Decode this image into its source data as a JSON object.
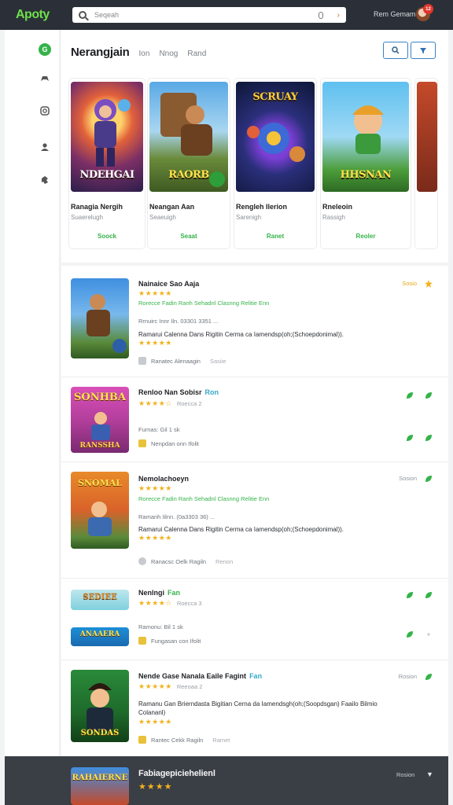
{
  "app": {
    "logo": "Apoty",
    "search_value": "Seqeah",
    "user_name": "Rem Gemam",
    "notif_count": "12"
  },
  "sidebar": {
    "items": [
      {
        "icon": "store-icon",
        "label": "G"
      },
      {
        "icon": "gamepad-icon"
      },
      {
        "icon": "instagram-icon"
      },
      {
        "icon": "user-icon"
      },
      {
        "icon": "puzzle-icon"
      }
    ]
  },
  "featured": {
    "tabs": [
      "Nerangjain",
      "Ion",
      "Nnog",
      "Rand"
    ],
    "cards": [
      {
        "cover_text": "NDEHGAI",
        "title": "Ranagia Nergih",
        "sub": "Suaerelugh",
        "button": "Soock"
      },
      {
        "cover_text": "RAORB",
        "title": "Neangan Aan",
        "sub": "Seaeuigh",
        "button": "Seaat"
      },
      {
        "cover_text": "SCRUAY",
        "title": "Rengleh Ilerion",
        "sub": "Sarenigh",
        "button": "Ranet"
      },
      {
        "cover_text": "HHSNAN",
        "title": "Rneleoin",
        "sub": "Rassigh",
        "button": "Reoler"
      }
    ]
  },
  "list": {
    "rows": [
      {
        "title": "Nainaice Sao Aaja",
        "tag": "",
        "rating": 5,
        "rating_meta": "",
        "green": "Rorecce Fadin Ranh   Sehadnl Clasnng Relitie Enn",
        "grey": "Rrnuirc Innr Iln. 03301 3351  ...",
        "desc": "Ramarui Calenna Dans Rigitin Cerma ca Iamendsp(oh;(Schoepdonimal)).",
        "rating2": 5,
        "foot": "Ranatec Alenaagin",
        "foot_ghost": "Sasiie",
        "status": "Sosio",
        "status_gold": true
      },
      {
        "title": "Renloo Nan Sobisr",
        "tag": "Ron",
        "rating": 4,
        "rating_meta": "Roecca 2",
        "grey": "Furnas:    Gil        1   sk",
        "foot": "Nenpdan onn Ifolit",
        "status": ""
      },
      {
        "title": "Nemolachoeyn",
        "tag": "",
        "rating": 5,
        "rating_meta": "",
        "green": "Rorecce Fadin Ranh   Sehadnl Clasnng Relitie Enn",
        "grey": "Ramanh Iilnn. (0a3303 36)  ...",
        "desc": "Ramarui Calenna Dans Rigitin Cerma ca Iamendsp(oh;(Schoepdonimal)).",
        "rating2": 5,
        "foot": "Ranacsc Oelk Ragiln",
        "foot_ghost": "Renon",
        "status": "Sosion",
        "status_gold": false
      },
      {
        "title": "Nenlngi",
        "tag": "Fan",
        "rating": 4,
        "rating_meta": "Roecca 3",
        "grey": "Ramonu:    Bil        1   sk",
        "foot": "Fungasan con Ifolit",
        "status": ""
      },
      {
        "title": "Nende Gase Nanala Eaile Fagint",
        "tag": "Fan",
        "rating": 5,
        "rating_meta": "Reeoaa 2",
        "desc": "Ramanu Gan Brierndasta Bigitian Cerna da Iamendsgh(oh;(Soopdsgan) Faailo Bilmio Colananl)",
        "rating2": 5,
        "foot": "Rantec Cekk Ragiln",
        "foot_ghost": "Ramet",
        "status": "Rosion",
        "status_gold": false
      }
    ]
  },
  "bottom": {
    "title": "Fabiagepiciehelienl",
    "rating": 4,
    "status": "Rosion"
  },
  "colors": {
    "accent_green": "#35b34a",
    "star": "#f2b21c",
    "topbar": "#2b3038"
  }
}
